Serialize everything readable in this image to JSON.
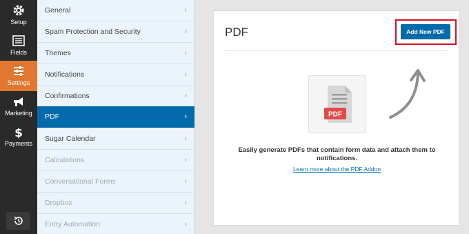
{
  "rail": {
    "items": [
      {
        "label": "Setup",
        "icon": "gear-icon"
      },
      {
        "label": "Fields",
        "icon": "list-icon"
      },
      {
        "label": "Settings",
        "icon": "sliders-icon"
      },
      {
        "label": "Marketing",
        "icon": "megaphone-icon"
      },
      {
        "label": "Payments",
        "icon": "dollar-icon"
      }
    ],
    "bottom_icon": "history-icon",
    "active_color": "#e27730"
  },
  "menu": {
    "items": [
      {
        "label": "General"
      },
      {
        "label": "Spam Protection and Security"
      },
      {
        "label": "Themes"
      },
      {
        "label": "Notifications"
      },
      {
        "label": "Confirmations"
      },
      {
        "label": "PDF"
      },
      {
        "label": "Sugar Calendar"
      },
      {
        "label": "Calculations"
      },
      {
        "label": "Conversational Forms"
      },
      {
        "label": "Dropbox"
      },
      {
        "label": "Entry Automation"
      }
    ],
    "chevron": "›",
    "active_color": "#036aab"
  },
  "main": {
    "title": "PDF",
    "add_button": "Add New PDF",
    "pdf_badge": "PDF",
    "description": "Easily generate PDFs that contain form data and attach them to notifications.",
    "learn_more": "Learn more about the PDF Addon",
    "accent_color": "#036aab",
    "highlight_color": "#d40f1f"
  }
}
